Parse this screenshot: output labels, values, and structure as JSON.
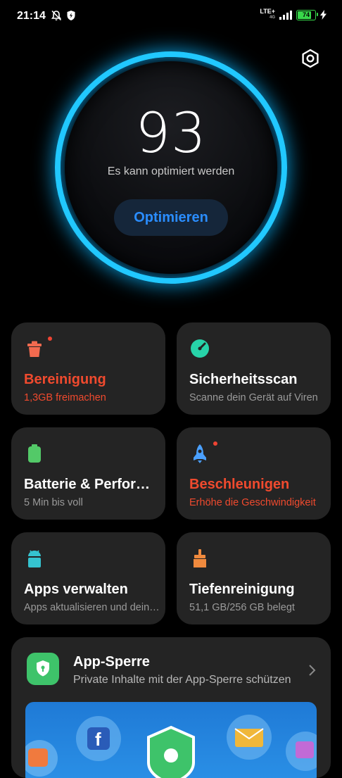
{
  "status": {
    "time": "21:14",
    "network": "LTE+",
    "network_sub": "4G",
    "battery": "74"
  },
  "score": {
    "value": "93",
    "message": "Es kann optimiert werden",
    "button": "Optimieren"
  },
  "cards": [
    {
      "title": "Bereinigung",
      "sub": "1,3GB freimachen",
      "icon": "trash-icon",
      "color": "#f26a4f"
    },
    {
      "title": "Sicherheitsscan",
      "sub": "Scanne dein Gerät auf Viren",
      "icon": "shield-scan-icon",
      "color": "#27d3a9"
    },
    {
      "title": "Batterie & Performance",
      "sub": "5 Min  bis voll",
      "icon": "battery-icon",
      "color": "#53c968"
    },
    {
      "title": "Beschleunigen",
      "sub": "Erhöhe die Geschwindigkeit",
      "icon": "rocket-icon",
      "color": "#4aa0ff"
    },
    {
      "title": "Apps verwalten",
      "sub": "Apps aktualisieren und deinstallieren",
      "icon": "android-icon",
      "color": "#35c3cf"
    },
    {
      "title": "Tiefenreinigung",
      "sub": "51,1 GB/256 GB belegt",
      "icon": "broom-icon",
      "color": "#f08a3e"
    }
  ],
  "app_lock": {
    "title": "App-Sperre",
    "sub": "Private Inhalte mit der App-Sperre schützen"
  },
  "colors": {
    "accent_blue": "#2a8dff",
    "ring": "#21c8ff",
    "alert_red": "#f04a2e"
  }
}
